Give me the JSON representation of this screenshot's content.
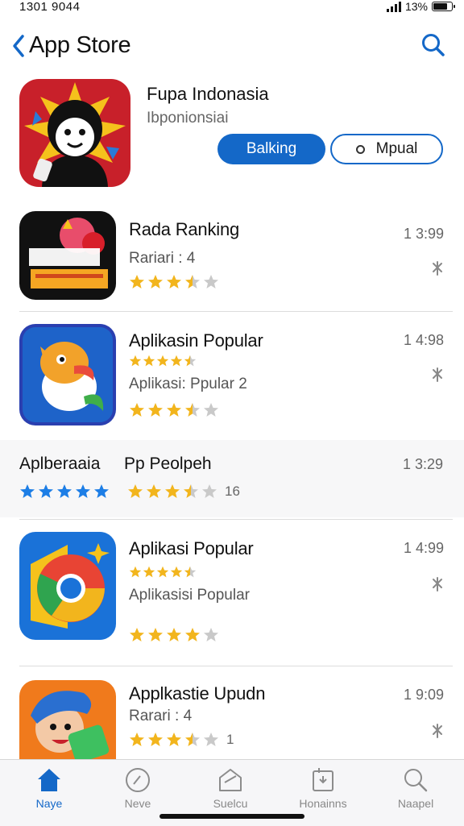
{
  "status": {
    "time": "1301 9044",
    "battery": "13%",
    "battery_level": 0.85
  },
  "nav": {
    "back_label": "App Store"
  },
  "featured": {
    "name": "Fupa Indonasia",
    "subtitle": "Ibponionsiai",
    "primary_button": "Balking",
    "secondary_button": "Mpual"
  },
  "apps": [
    {
      "title": "Rada Ranking",
      "line1": "Rariari : 4",
      "price": "1 3:99",
      "rating": 3.5
    },
    {
      "title": "Aplikasin Popular",
      "line1": "Aplikasi: Ppular  2",
      "price": "1 4:98",
      "rating": 3.5,
      "small_rating": 4.5
    },
    {
      "title": "Aplikasi Popular",
      "line1": "Aplikasisi Popular",
      "price": "1 4:99",
      "rating": 4,
      "small_rating": 4.5
    },
    {
      "title": "Applkastie Upudn",
      "line1": "Rarari : 4",
      "price": "1 9:09",
      "rating": 3.5,
      "rating_count": "1"
    }
  ],
  "band": {
    "left_label": "Aplberaaia",
    "right_label": "Pp Peolpeh",
    "price": "1 3:29",
    "left_rating": 5,
    "right_rating": 3.5,
    "rating_count": "16"
  },
  "tabs": [
    {
      "label": "Naye",
      "icon": "home-icon",
      "active": true
    },
    {
      "label": "Neve",
      "icon": "compass-icon"
    },
    {
      "label": "Suelcu",
      "icon": "stack-icon"
    },
    {
      "label": "Honainns",
      "icon": "updates-icon"
    },
    {
      "label": "Naapel",
      "icon": "search-icon"
    }
  ],
  "colors": {
    "accent": "#1468c8",
    "star": "#f2b51d",
    "star_empty": "#c9c9c9",
    "band_star": "#1d7ee6"
  }
}
